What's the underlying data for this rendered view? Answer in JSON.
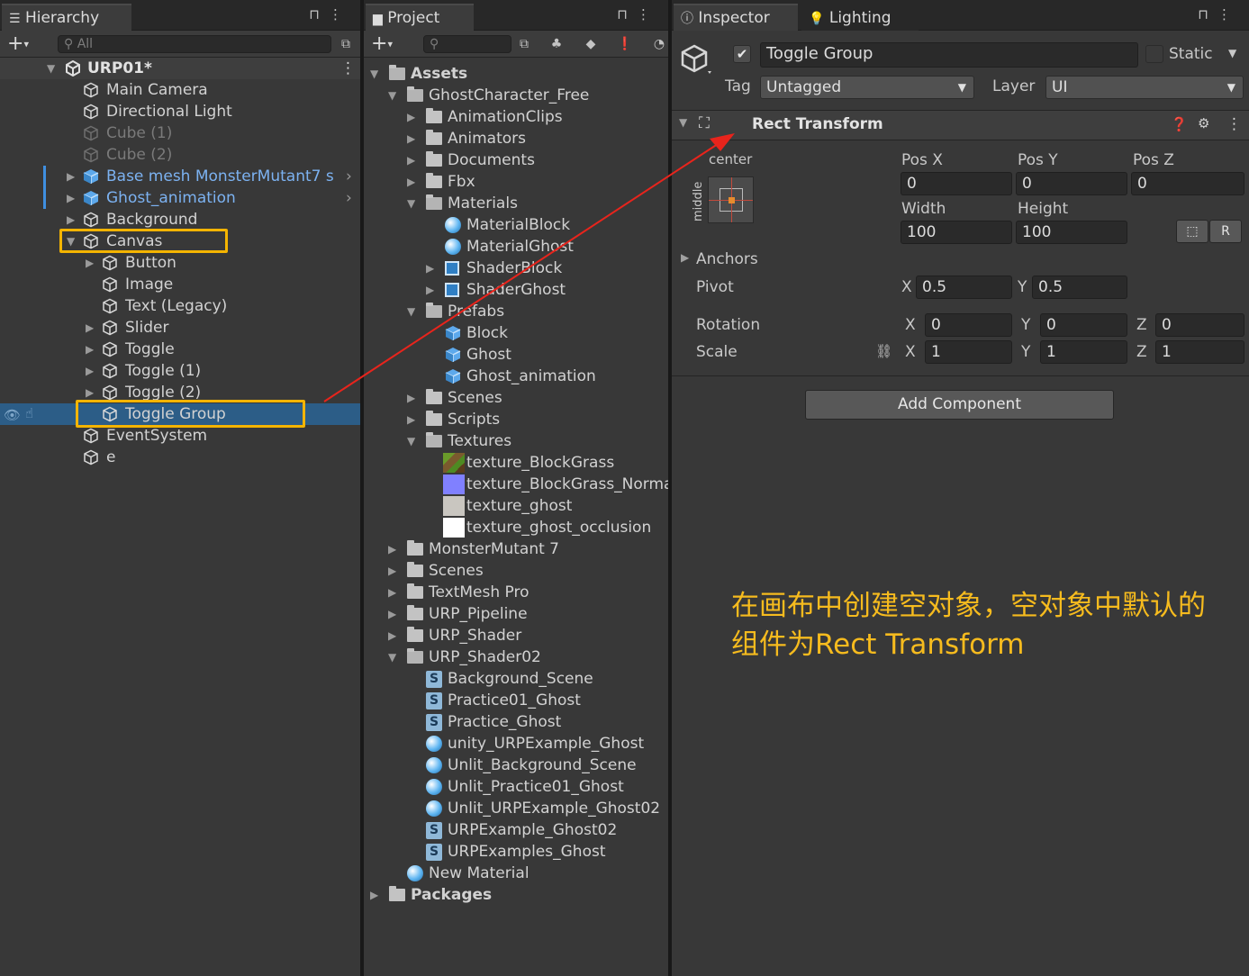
{
  "hierarchy": {
    "tab": "Hierarchy",
    "search_placeholder": "All",
    "scene": "URP01*",
    "items": [
      {
        "label": "Main Camera",
        "depth": 1,
        "kind": "object",
        "state": "normal",
        "arrow": ""
      },
      {
        "label": "Directional Light",
        "depth": 1,
        "kind": "object",
        "state": "normal",
        "arrow": ""
      },
      {
        "label": "Cube (1)",
        "depth": 1,
        "kind": "object",
        "state": "disabled",
        "arrow": ""
      },
      {
        "label": "Cube (2)",
        "depth": 1,
        "kind": "object",
        "state": "disabled",
        "arrow": ""
      },
      {
        "label": "Base mesh MonsterMutant7 s",
        "depth": 1,
        "kind": "prefab",
        "state": "prefab",
        "arrow": "collapsed"
      },
      {
        "label": "Ghost_animation",
        "depth": 1,
        "kind": "prefab",
        "state": "prefab",
        "arrow": "collapsed"
      },
      {
        "label": "Background",
        "depth": 1,
        "kind": "object",
        "state": "normal",
        "arrow": "collapsed"
      },
      {
        "label": "Canvas",
        "depth": 1,
        "kind": "object",
        "state": "normal",
        "arrow": "expanded"
      },
      {
        "label": "Button",
        "depth": 2,
        "kind": "object",
        "state": "normal",
        "arrow": "collapsed"
      },
      {
        "label": "Image",
        "depth": 2,
        "kind": "object",
        "state": "normal",
        "arrow": ""
      },
      {
        "label": "Text (Legacy)",
        "depth": 2,
        "kind": "object",
        "state": "normal",
        "arrow": ""
      },
      {
        "label": "Slider",
        "depth": 2,
        "kind": "object",
        "state": "normal",
        "arrow": "collapsed"
      },
      {
        "label": "Toggle",
        "depth": 2,
        "kind": "object",
        "state": "normal",
        "arrow": "collapsed"
      },
      {
        "label": "Toggle (1)",
        "depth": 2,
        "kind": "object",
        "state": "normal",
        "arrow": "collapsed"
      },
      {
        "label": "Toggle (2)",
        "depth": 2,
        "kind": "object",
        "state": "normal",
        "arrow": "collapsed"
      },
      {
        "label": "Toggle Group",
        "depth": 2,
        "kind": "object",
        "state": "selected",
        "arrow": ""
      },
      {
        "label": "EventSystem",
        "depth": 1,
        "kind": "object",
        "state": "normal",
        "arrow": ""
      },
      {
        "label": "e",
        "depth": 1,
        "kind": "object",
        "state": "normal",
        "arrow": ""
      }
    ]
  },
  "project": {
    "tab": "Project",
    "items": [
      {
        "label": "Assets",
        "depth": 0,
        "kind": "folder-open",
        "arrow": "expanded",
        "bold": true
      },
      {
        "label": "GhostCharacter_Free",
        "depth": 1,
        "kind": "folder-open",
        "arrow": "expanded"
      },
      {
        "label": "AnimationClips",
        "depth": 2,
        "kind": "folder",
        "arrow": "collapsed"
      },
      {
        "label": "Animators",
        "depth": 2,
        "kind": "folder",
        "arrow": "collapsed"
      },
      {
        "label": "Documents",
        "depth": 2,
        "kind": "folder",
        "arrow": "collapsed"
      },
      {
        "label": "Fbx",
        "depth": 2,
        "kind": "folder",
        "arrow": "collapsed"
      },
      {
        "label": "Materials",
        "depth": 2,
        "kind": "folder-open",
        "arrow": "expanded"
      },
      {
        "label": "MaterialBlock",
        "depth": 3,
        "kind": "material",
        "arrow": ""
      },
      {
        "label": "MaterialGhost",
        "depth": 3,
        "kind": "material",
        "arrow": ""
      },
      {
        "label": "ShaderBlock",
        "depth": 3,
        "kind": "shadergraph",
        "arrow": "collapsed"
      },
      {
        "label": "ShaderGhost",
        "depth": 3,
        "kind": "shadergraph",
        "arrow": "collapsed"
      },
      {
        "label": "Prefabs",
        "depth": 2,
        "kind": "folder-open",
        "arrow": "expanded"
      },
      {
        "label": "Block",
        "depth": 3,
        "kind": "prefab",
        "arrow": ""
      },
      {
        "label": "Ghost",
        "depth": 3,
        "kind": "prefab",
        "arrow": ""
      },
      {
        "label": "Ghost_animation",
        "depth": 3,
        "kind": "prefab",
        "arrow": ""
      },
      {
        "label": "Scenes",
        "depth": 2,
        "kind": "folder",
        "arrow": "collapsed"
      },
      {
        "label": "Scripts",
        "depth": 2,
        "kind": "folder",
        "arrow": "collapsed"
      },
      {
        "label": "Textures",
        "depth": 2,
        "kind": "folder-open",
        "arrow": "expanded"
      },
      {
        "label": "texture_BlockGrass",
        "depth": 3,
        "kind": "tex-grass",
        "arrow": ""
      },
      {
        "label": "texture_BlockGrass_Norma",
        "depth": 3,
        "kind": "tex-normal",
        "arrow": ""
      },
      {
        "label": "texture_ghost",
        "depth": 3,
        "kind": "tex-ghost",
        "arrow": ""
      },
      {
        "label": "texture_ghost_occlusion",
        "depth": 3,
        "kind": "tex-white",
        "arrow": ""
      },
      {
        "label": "MonsterMutant 7",
        "depth": 1,
        "kind": "folder",
        "arrow": "collapsed"
      },
      {
        "label": "Scenes",
        "depth": 1,
        "kind": "folder",
        "arrow": "collapsed"
      },
      {
        "label": "TextMesh Pro",
        "depth": 1,
        "kind": "folder",
        "arrow": "collapsed"
      },
      {
        "label": "URP_Pipeline",
        "depth": 1,
        "kind": "folder",
        "arrow": "collapsed"
      },
      {
        "label": "URP_Shader",
        "depth": 1,
        "kind": "folder",
        "arrow": "collapsed"
      },
      {
        "label": "URP_Shader02",
        "depth": 1,
        "kind": "folder-open",
        "arrow": "expanded"
      },
      {
        "label": "Background_Scene",
        "depth": 2,
        "kind": "shader",
        "arrow": ""
      },
      {
        "label": "Practice01_Ghost",
        "depth": 2,
        "kind": "shader",
        "arrow": ""
      },
      {
        "label": "Practice_Ghost",
        "depth": 2,
        "kind": "shader",
        "arrow": ""
      },
      {
        "label": "unity_URPExample_Ghost",
        "depth": 2,
        "kind": "material",
        "arrow": ""
      },
      {
        "label": "Unlit_Background_Scene",
        "depth": 2,
        "kind": "material",
        "arrow": ""
      },
      {
        "label": "Unlit_Practice01_Ghost",
        "depth": 2,
        "kind": "material",
        "arrow": ""
      },
      {
        "label": "Unlit_URPExample_Ghost02",
        "depth": 2,
        "kind": "material",
        "arrow": ""
      },
      {
        "label": "URPExample_Ghost02",
        "depth": 2,
        "kind": "shader",
        "arrow": ""
      },
      {
        "label": "URPExamples_Ghost",
        "depth": 2,
        "kind": "shader",
        "arrow": ""
      },
      {
        "label": "New Material",
        "depth": 1,
        "kind": "material",
        "arrow": ""
      },
      {
        "label": "Packages",
        "depth": 0,
        "kind": "folder",
        "arrow": "collapsed",
        "bold": true
      }
    ]
  },
  "inspector": {
    "tabs": [
      "Inspector",
      "Lighting"
    ],
    "object_name": "Toggle Group",
    "static_label": "Static",
    "tag_label": "Tag",
    "tag_value": "Untagged",
    "layer_label": "Layer",
    "layer_value": "UI",
    "component_title": "Rect Transform",
    "anchor_h": "center",
    "anchor_v": "middle",
    "posx_label": "Pos X",
    "posx": "0",
    "posy_label": "Pos Y",
    "posy": "0",
    "posz_label": "Pos Z",
    "posz": "0",
    "width_label": "Width",
    "width": "100",
    "height_label": "Height",
    "height": "100",
    "anchors_label": "Anchors",
    "pivot_label": "Pivot",
    "pivot_x": "0.5",
    "pivot_y": "0.5",
    "rotation_label": "Rotation",
    "rot_x": "0",
    "rot_y": "0",
    "rot_z": "0",
    "scale_label": "Scale",
    "scale_x": "1",
    "scale_y": "1",
    "scale_z": "1",
    "x_label": "X",
    "y_label": "Y",
    "z_label": "Z",
    "add_component": "Add Component"
  },
  "annotation": {
    "line1": "在画布中创建空对象，空对象中默认的",
    "line2": "组件为Rect Transform",
    "color": "#f6bb1e"
  },
  "colors": {
    "selection": "#2c5d87",
    "highlight_box": "#f4b400",
    "arrow": "#e8241c",
    "prefab_text": "#7cb2f1"
  }
}
